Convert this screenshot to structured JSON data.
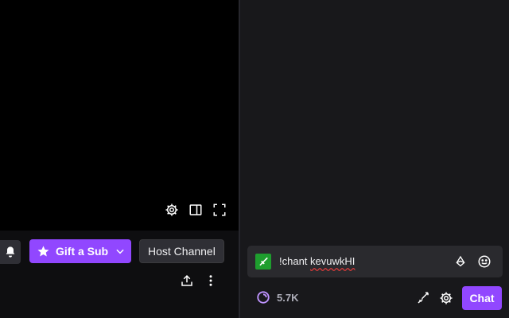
{
  "player": {
    "controls": [
      {
        "icon": "gear-icon"
      },
      {
        "icon": "theatre-mode-icon"
      },
      {
        "icon": "fullscreen-icon"
      }
    ]
  },
  "actions": {
    "notifications_icon": "bell-icon",
    "gift_label": "Gift a Sub",
    "tooltip_text": "Host Channel",
    "share_icon": "share-icon",
    "more_icon": "more-vertical-icon"
  },
  "chat": {
    "input_badge_icon": "sword-badge-icon",
    "input_word_1": "!chant ",
    "input_word_2": "kevuwkHI",
    "points_value": "5.7K",
    "send_label": "Chat"
  },
  "colors": {
    "accent": "#9147ff",
    "badge": "#1e9e2e",
    "chat_bg": "#18181b",
    "page_bg": "#0e0e10"
  }
}
